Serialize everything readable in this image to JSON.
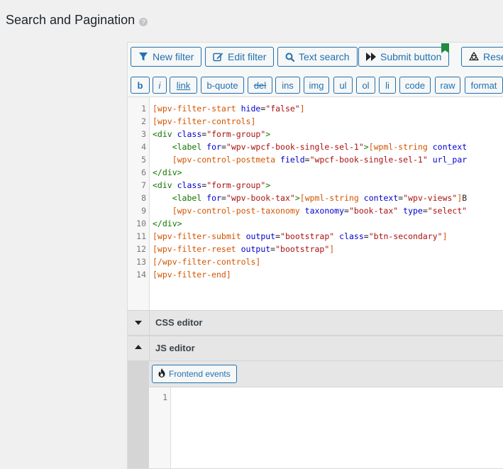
{
  "page": {
    "title": "Search and Pagination",
    "help_icon_glyph": "?"
  },
  "toolbar": {
    "buttons": [
      {
        "label": "New filter",
        "icon": "filter-icon"
      },
      {
        "label": "Edit filter",
        "icon": "edit-icon"
      },
      {
        "label": "Text search",
        "icon": "search-icon"
      },
      {
        "label": "Submit button",
        "icon": "fast-forward-icon",
        "bookmark": true
      },
      {
        "label": "Rese",
        "icon": "recycle-icon"
      }
    ]
  },
  "quicktags": [
    "b",
    "i",
    "link",
    "b-quote",
    "del",
    "ins",
    "img",
    "ul",
    "ol",
    "li",
    "code",
    "raw",
    "format"
  ],
  "code": {
    "line_numbers": [
      "1",
      "2",
      "3",
      "4",
      "5",
      "6",
      "7",
      "8",
      "9",
      "10",
      "11",
      "12",
      "13",
      "14"
    ],
    "lines": [
      [
        [
          "sc",
          "[wpv-filter-start "
        ],
        [
          "attr",
          "hide"
        ],
        [
          "txt",
          "="
        ],
        [
          "str",
          "\"false\""
        ],
        [
          "sc",
          "]"
        ]
      ],
      [
        [
          "sc",
          "[wpv-filter-controls]"
        ]
      ],
      [
        [
          "tag",
          "<div "
        ],
        [
          "attr",
          "class"
        ],
        [
          "txt",
          "="
        ],
        [
          "str",
          "\"form-group\""
        ],
        [
          "tag",
          ">"
        ]
      ],
      [
        [
          "txt",
          "    "
        ],
        [
          "tag",
          "<label "
        ],
        [
          "attr",
          "for"
        ],
        [
          "txt",
          "="
        ],
        [
          "str",
          "\"wpv-wpcf-book-single-sel-1\""
        ],
        [
          "tag",
          ">"
        ],
        [
          "sc",
          "[wpml-string "
        ],
        [
          "attr",
          "context"
        ]
      ],
      [
        [
          "txt",
          "    "
        ],
        [
          "sc",
          "[wpv-control-postmeta "
        ],
        [
          "attr",
          "field"
        ],
        [
          "txt",
          "="
        ],
        [
          "str",
          "\"wpcf-book-single-sel-1\""
        ],
        [
          "txt",
          " "
        ],
        [
          "attr",
          "url_par"
        ]
      ],
      [
        [
          "tag",
          "</div>"
        ]
      ],
      [
        [
          "tag",
          "<div "
        ],
        [
          "attr",
          "class"
        ],
        [
          "txt",
          "="
        ],
        [
          "str",
          "\"form-group\""
        ],
        [
          "tag",
          ">"
        ]
      ],
      [
        [
          "txt",
          "    "
        ],
        [
          "tag",
          "<label "
        ],
        [
          "attr",
          "for"
        ],
        [
          "txt",
          "="
        ],
        [
          "str",
          "\"wpv-book-tax\""
        ],
        [
          "tag",
          ">"
        ],
        [
          "sc",
          "[wpml-string "
        ],
        [
          "attr",
          "context"
        ],
        [
          "txt",
          "="
        ],
        [
          "str",
          "\"wpv-views\""
        ],
        [
          "sc",
          "]"
        ],
        [
          "txt",
          "B"
        ]
      ],
      [
        [
          "txt",
          "    "
        ],
        [
          "sc",
          "[wpv-control-post-taxonomy "
        ],
        [
          "attr",
          "taxonomy"
        ],
        [
          "txt",
          "="
        ],
        [
          "str",
          "\"book-tax\""
        ],
        [
          "txt",
          " "
        ],
        [
          "attr",
          "type"
        ],
        [
          "txt",
          "="
        ],
        [
          "str",
          "\"select\""
        ]
      ],
      [
        [
          "tag",
          "</div>"
        ]
      ],
      [
        [
          "sc",
          "[wpv-filter-submit "
        ],
        [
          "attr",
          "output"
        ],
        [
          "txt",
          "="
        ],
        [
          "str",
          "\"bootstrap\""
        ],
        [
          "txt",
          " "
        ],
        [
          "attr",
          "class"
        ],
        [
          "txt",
          "="
        ],
        [
          "str",
          "\"btn-secondary\""
        ],
        [
          "sc",
          "]"
        ]
      ],
      [
        [
          "sc",
          "[wpv-filter-reset "
        ],
        [
          "attr",
          "output"
        ],
        [
          "txt",
          "="
        ],
        [
          "str",
          "\"bootstrap\""
        ],
        [
          "sc",
          "]"
        ]
      ],
      [
        [
          "sc",
          "[/wpv-filter-controls]"
        ]
      ],
      [
        [
          "sc",
          "[wpv-filter-end]"
        ]
      ]
    ]
  },
  "sections": {
    "css_editor": "CSS editor",
    "js_editor": "JS editor"
  },
  "js": {
    "frontend_events_label": "Frontend events",
    "line_number": "1"
  },
  "colors": {
    "accent": "#2271b1",
    "bookmark": "#1e8b3e",
    "shortcode": "#d35400",
    "tag": "#117700",
    "attribute": "#0000cc",
    "string": "#aa1111"
  }
}
